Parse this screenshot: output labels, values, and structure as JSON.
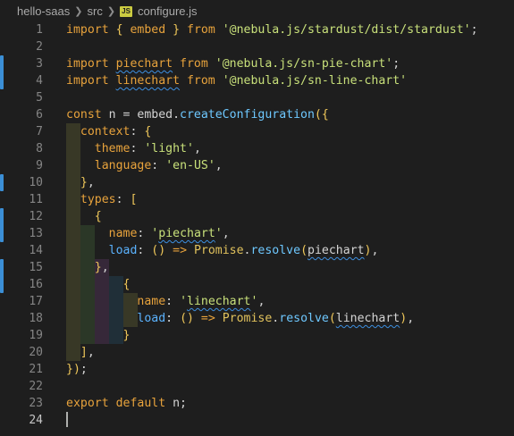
{
  "breadcrumb": {
    "root": "hello-saas",
    "folder": "src",
    "file_badge": "JS",
    "file": "configure.js"
  },
  "colors": {
    "background": "#1e1e1e",
    "keyword": "#e8a33c",
    "string": "#c8e07a",
    "property": "#5bb3ff",
    "gutter_modified": "#3b8fd6"
  },
  "lines": [
    {
      "n": "1",
      "t": [
        [
          "kw",
          "import "
        ],
        [
          "br",
          "{ "
        ],
        [
          "kw",
          "embed "
        ],
        [
          "br",
          "} "
        ],
        [
          "kw",
          "from "
        ],
        [
          "str",
          "'@nebula.js/stardust/dist/stardust'"
        ],
        [
          "plain",
          ";"
        ]
      ]
    },
    {
      "n": "2",
      "t": []
    },
    {
      "n": "3",
      "t": [
        [
          "kw",
          "import "
        ],
        [
          "kw sq",
          "piechart"
        ],
        [
          "kw",
          " from "
        ],
        [
          "str",
          "'@nebula.js/sn-pie-chart'"
        ],
        [
          "plain",
          ";"
        ]
      ]
    },
    {
      "n": "4",
      "t": [
        [
          "kw",
          "import "
        ],
        [
          "kw sq",
          "linechart"
        ],
        [
          "kw",
          " from "
        ],
        [
          "str",
          "'@nebula.js/sn-line-chart'"
        ]
      ]
    },
    {
      "n": "5",
      "t": []
    },
    {
      "n": "6",
      "t": [
        [
          "kw",
          "const "
        ],
        [
          "plain",
          "n = embed."
        ],
        [
          "fn",
          "createConfiguration"
        ],
        [
          "br",
          "({"
        ]
      ]
    },
    {
      "n": "7",
      "t": [
        [
          "plain",
          "  "
        ],
        [
          "kw",
          "context"
        ],
        [
          "plain",
          ": "
        ],
        [
          "br",
          "{"
        ]
      ]
    },
    {
      "n": "8",
      "t": [
        [
          "plain",
          "    "
        ],
        [
          "kw",
          "theme"
        ],
        [
          "plain",
          ": "
        ],
        [
          "str",
          "'light'"
        ],
        [
          "plain",
          ","
        ]
      ]
    },
    {
      "n": "9",
      "t": [
        [
          "plain",
          "    "
        ],
        [
          "kw",
          "language"
        ],
        [
          "plain",
          ": "
        ],
        [
          "str",
          "'en-US'"
        ],
        [
          "plain",
          ","
        ]
      ]
    },
    {
      "n": "10",
      "t": [
        [
          "plain",
          "  "
        ],
        [
          "br",
          "}"
        ],
        [
          "plain",
          ","
        ]
      ]
    },
    {
      "n": "11",
      "t": [
        [
          "plain",
          "  "
        ],
        [
          "kw",
          "types"
        ],
        [
          "plain",
          ": "
        ],
        [
          "br",
          "["
        ]
      ]
    },
    {
      "n": "12",
      "t": [
        [
          "plain",
          "    "
        ],
        [
          "br",
          "{"
        ]
      ]
    },
    {
      "n": "13",
      "t": [
        [
          "plain",
          "      "
        ],
        [
          "kw",
          "name"
        ],
        [
          "plain",
          ": "
        ],
        [
          "str",
          "'"
        ],
        [
          "str sq",
          "piechart"
        ],
        [
          "str",
          "'"
        ],
        [
          "plain",
          ","
        ]
      ]
    },
    {
      "n": "14",
      "t": [
        [
          "plain",
          "      "
        ],
        [
          "prop",
          "load"
        ],
        [
          "plain",
          ": "
        ],
        [
          "br",
          "() "
        ],
        [
          "kw",
          "=> "
        ],
        [
          "cls",
          "Promise"
        ],
        [
          "plain",
          "."
        ],
        [
          "fn",
          "resolve"
        ],
        [
          "br",
          "("
        ],
        [
          "plain sq",
          "piechart"
        ],
        [
          "br",
          ")"
        ],
        [
          "plain",
          ","
        ]
      ]
    },
    {
      "n": "15",
      "t": [
        [
          "plain",
          "    "
        ],
        [
          "br",
          "}"
        ],
        [
          "plain",
          ","
        ]
      ]
    },
    {
      "n": "16",
      "t": [
        [
          "plain",
          "        "
        ],
        [
          "br",
          "{"
        ]
      ]
    },
    {
      "n": "17",
      "t": [
        [
          "plain",
          "          "
        ],
        [
          "kw",
          "name"
        ],
        [
          "plain",
          ": "
        ],
        [
          "str",
          "'"
        ],
        [
          "str sq",
          "linechart"
        ],
        [
          "str",
          "'"
        ],
        [
          "plain",
          ","
        ]
      ]
    },
    {
      "n": "18",
      "t": [
        [
          "plain",
          "          "
        ],
        [
          "prop",
          "load"
        ],
        [
          "plain",
          ": "
        ],
        [
          "br",
          "() "
        ],
        [
          "kw",
          "=> "
        ],
        [
          "cls",
          "Promise"
        ],
        [
          "plain",
          "."
        ],
        [
          "fn",
          "resolve"
        ],
        [
          "br",
          "("
        ],
        [
          "plain sq",
          "linechart"
        ],
        [
          "br",
          ")"
        ],
        [
          "plain",
          ","
        ]
      ]
    },
    {
      "n": "19",
      "t": [
        [
          "plain",
          "        "
        ],
        [
          "br",
          "}"
        ]
      ]
    },
    {
      "n": "20",
      "t": [
        [
          "plain",
          "  "
        ],
        [
          "br",
          "]"
        ],
        [
          "plain",
          ","
        ]
      ]
    },
    {
      "n": "21",
      "t": [
        [
          "br",
          "})"
        ],
        [
          "plain",
          ";"
        ]
      ]
    },
    {
      "n": "22",
      "t": []
    },
    {
      "n": "23",
      "t": [
        [
          "kw",
          "export default "
        ],
        [
          "plain",
          "n;"
        ]
      ]
    },
    {
      "n": "24",
      "t": []
    }
  ]
}
